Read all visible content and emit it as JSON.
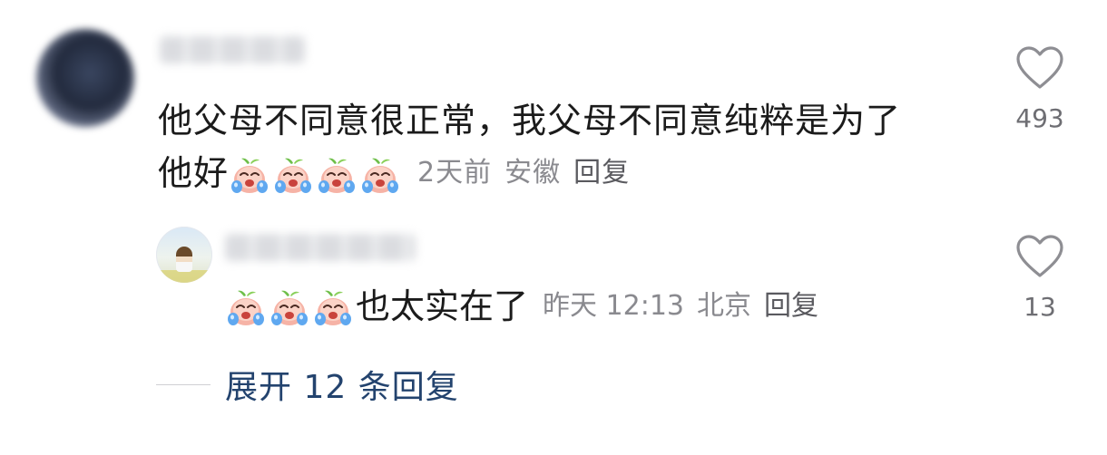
{
  "comment": {
    "text_line1": "他父母不同意很正常，我父母不同意纯粹是为了",
    "text_line2": "他好",
    "emoji_count": 4,
    "emoji_name": "crying-peach-emoji",
    "time": "2天前",
    "location": "安徽",
    "reply_label": "回复",
    "likes": "493"
  },
  "reply": {
    "emoji_count": 3,
    "emoji_name": "crying-peach-emoji",
    "text": "也太实在了",
    "time": "昨天 12:13",
    "location": "北京",
    "reply_label": "回复",
    "likes": "13"
  },
  "expand": {
    "label": "展开 12 条回复"
  },
  "colors": {
    "expand_link": "#23436e",
    "meta_text": "#8a8a8f",
    "heart_outline": "#8e8e93"
  }
}
